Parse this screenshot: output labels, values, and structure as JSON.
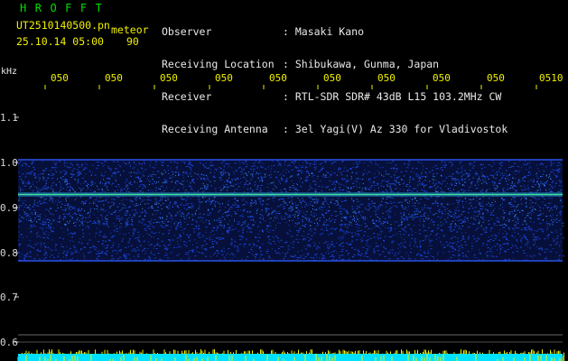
{
  "header": {
    "app_title": "HROFFT",
    "filename": "UT2510140500.pn",
    "event_label": "meteor",
    "datetime": "25.10.14 05:00",
    "count": "90"
  },
  "info": {
    "labels": [
      "Observer",
      "Receiving Location",
      "Receiver",
      "Receiving Antenna"
    ],
    "values": [
      ": Masaki Kano",
      ": Shibukawa, Gunma, Japan",
      ": RTL-SDR SDR# 43dB L15 103.2MHz CW",
      ": 3el Yagi(V) Az 330 for Vladivostok"
    ]
  },
  "axis": {
    "unit_label": "kHz",
    "y_ticks": [
      "1.1",
      "1.0",
      "0.9",
      "0.8",
      "0.7",
      "0.6"
    ],
    "x_ticks": [
      "050",
      "050",
      "050",
      "050",
      "050",
      "050",
      "050",
      "050",
      "050",
      "0510"
    ]
  },
  "colors": {
    "background": "#000000",
    "signal": "#2050ff",
    "carrier_line": "#40e0a0",
    "text_yellow": "#f0f000",
    "text_green": "#00e000",
    "text_white": "#e8e8e8",
    "bottom_trace_cyan": "#00e0ff",
    "bottom_trace_yellow": "#f0f000"
  }
}
